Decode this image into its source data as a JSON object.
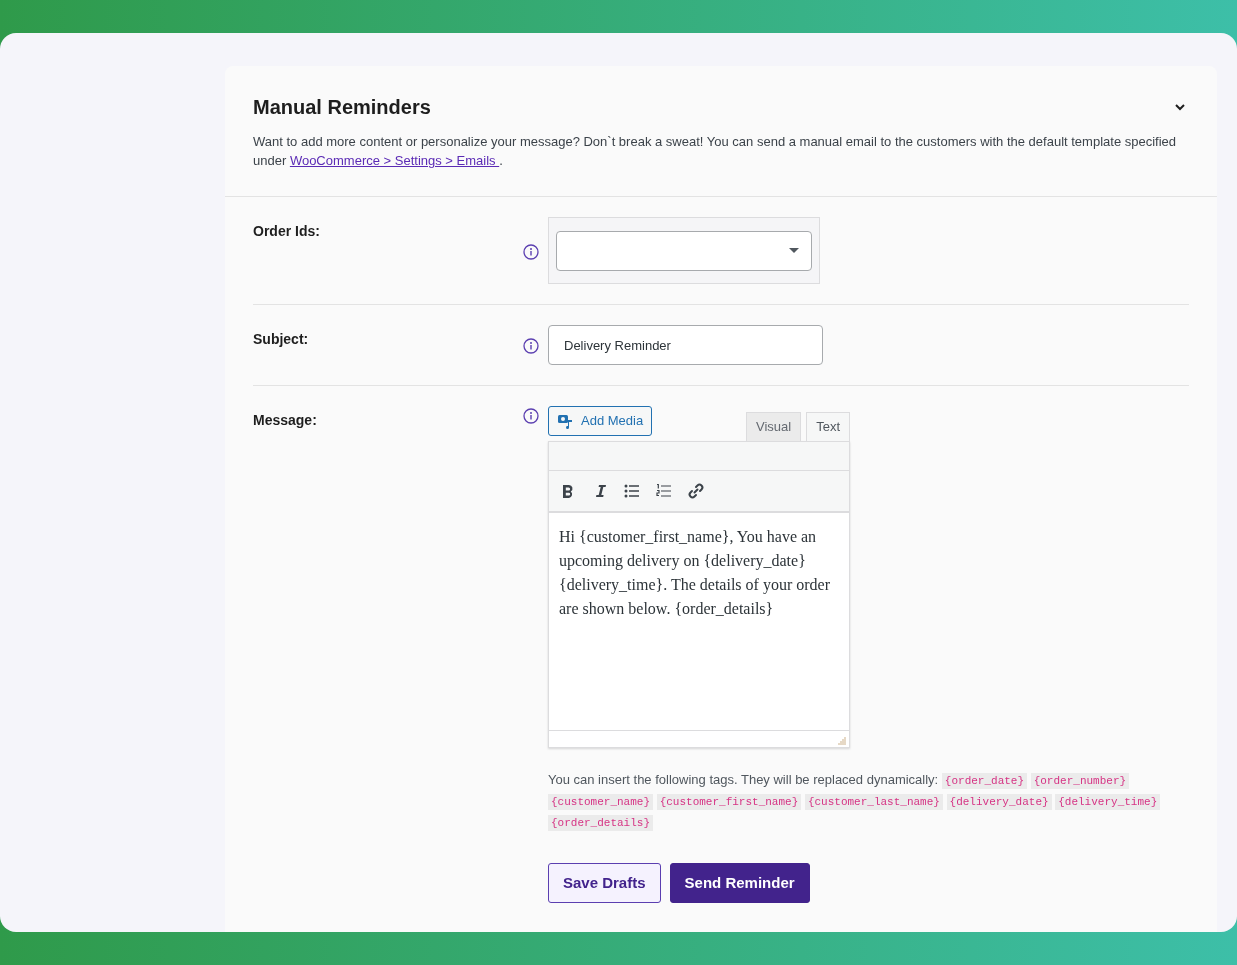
{
  "section": {
    "title": "Manual Reminders",
    "description_before": "Want to add more content or personalize your message? Don`t break a sweat! You can send a manual email to the customers with the default template specified under ",
    "link": "WooCommerce > Settings > Emails ",
    "description_after": "."
  },
  "fields": [
    {
      "kind": "select",
      "label": "Order Ids:"
    },
    {
      "kind": "text",
      "label": "Subject:",
      "value": "Delivery Reminder"
    },
    {
      "kind": "editor",
      "label": "Message:",
      "add_media": "Add Media",
      "tabs": [
        {
          "label": "Visual",
          "selected": false
        },
        {
          "label": "Text",
          "selected": true
        }
      ],
      "body": "Hi {customer_first_name}, You have an upcoming delivery on {delivery_date} {delivery_time}. The details of your order are shown below. {order_details}",
      "help": "You can insert the following tags. They will be replaced dynamically:",
      "tags": [
        "{order_date}",
        "{order_number}",
        "{customer_name}",
        "{customer_first_name}",
        "{customer_last_name}",
        "{delivery_date}",
        "{delivery_time}",
        "{order_details}"
      ]
    }
  ],
  "buttons": [
    {
      "label": "Save Drafts",
      "kind": "secondary"
    },
    {
      "label": "Send Reminder",
      "kind": "primary"
    }
  ]
}
